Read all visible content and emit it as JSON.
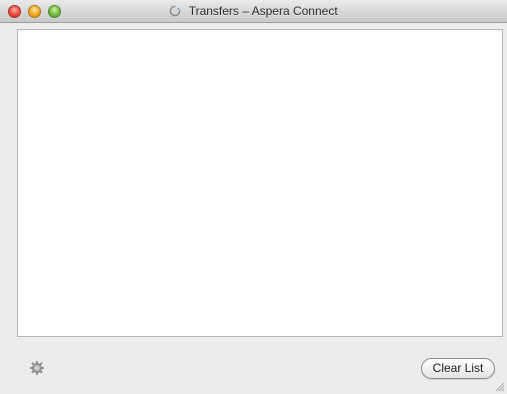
{
  "window": {
    "title": "Transfers – Aspera Connect",
    "title_icon": "refresh-spinner-icon",
    "controls": {
      "close_color": "#f0574a",
      "minimize_color": "#f5b12f",
      "zoom_color": "#7fc24a"
    }
  },
  "transfer_list": {
    "items": []
  },
  "footer": {
    "settings_icon": "gear-icon",
    "clear_label": "Clear List"
  },
  "colors": {
    "window_bg": "#ececec",
    "list_bg": "#ffffff"
  }
}
